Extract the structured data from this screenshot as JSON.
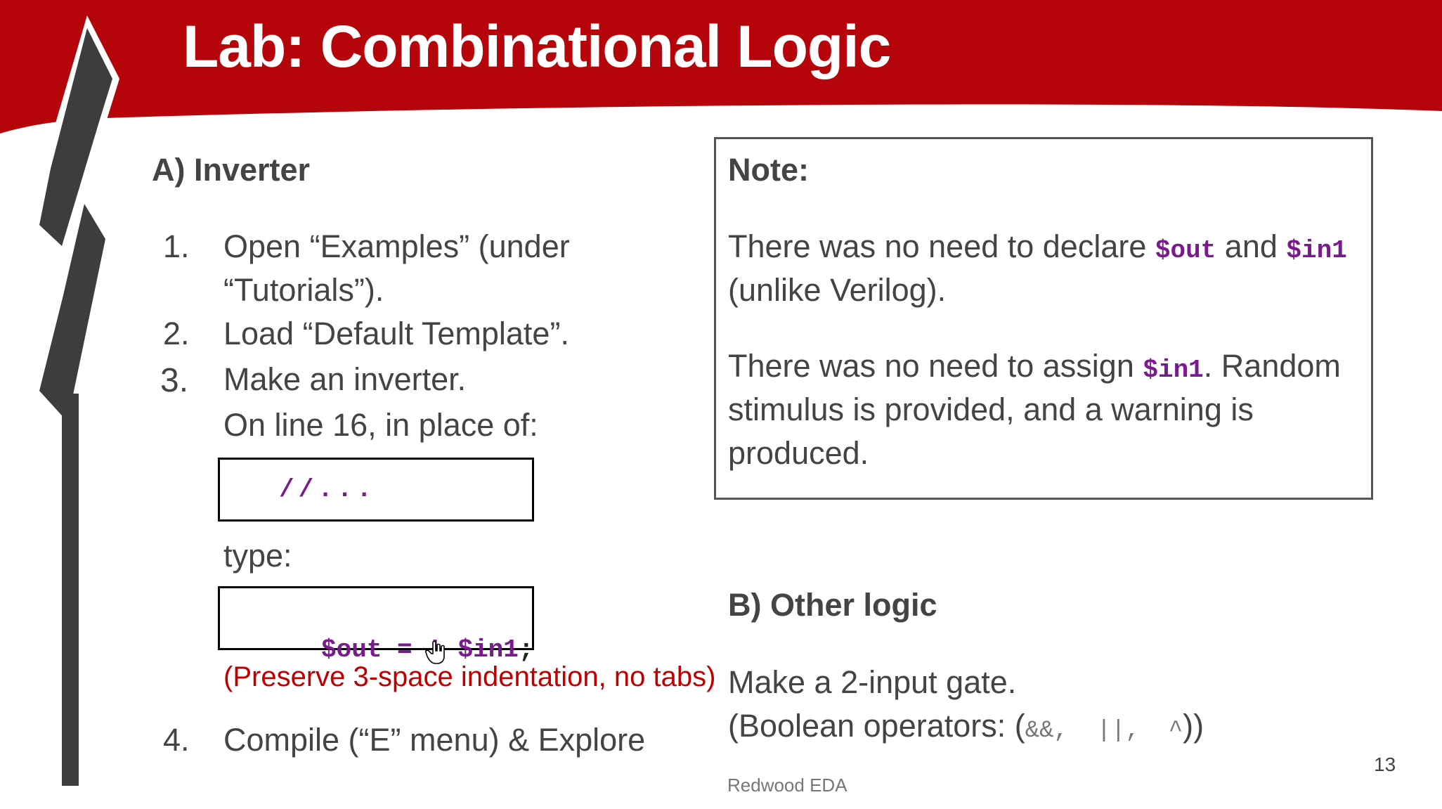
{
  "slide": {
    "title": "Lab: Combinational Logic",
    "section_a": {
      "heading": "A) Inverter",
      "steps": [
        {
          "num": "1.",
          "lines": [
            "Open “Examples” (under",
            "“Tutorials”)."
          ]
        },
        {
          "num": "2.",
          "lines": [
            "Load “Default Template”."
          ]
        },
        {
          "num": "3.",
          "lines": [
            "Make an inverter.",
            "On line 16, in place of:"
          ]
        },
        {
          "num": "4.",
          "lines": [
            "Compile (“E” menu) & Explore"
          ]
        }
      ],
      "code_placeholder": "//...",
      "type_label": "type:",
      "code_out": "$out",
      "code_eq": " = ! ",
      "code_in": "$in1",
      "code_semicolon": ";",
      "indent_note": "(Preserve 3-space indentation, no tabs)"
    },
    "note": {
      "heading": "Note:",
      "p1_part1": "There was no need to declare ",
      "p1_code1": "$out",
      "p1_part2": " and ",
      "p1_code2": "$in1",
      "p1_line2": "(unlike Verilog).",
      "p2_part1": "There was no need to assign ",
      "p2_code": "$in1",
      "p2_part2": ". Random",
      "p2_line2": "stimulus is provided, and a warning is",
      "p2_line3": "produced."
    },
    "section_b": {
      "heading": "B) Other logic",
      "line1": "Make a 2-input gate.",
      "line2_prefix": "(Boolean operators: (",
      "line2_ops": "&&,  ||,  ^",
      "line2_suffix": "))"
    },
    "footer": "Redwood EDA",
    "page_number": "13"
  },
  "colors": {
    "header_red": "#b5050b",
    "logo_dark": "#3d3d3d",
    "code_purple": "#7a1a8c",
    "warning_red": "#c00000",
    "text_gray": "#444444"
  },
  "icons": [
    "hand-pointer-cursor-icon",
    "redwood-logo"
  ]
}
